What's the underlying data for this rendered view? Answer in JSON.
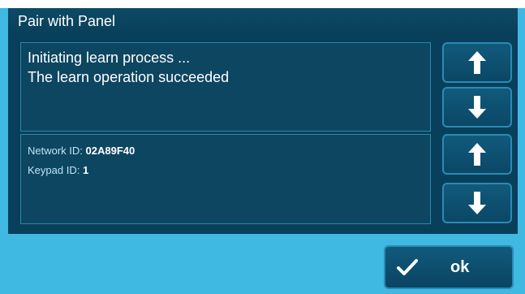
{
  "window": {
    "title": "Pair with Panel"
  },
  "log": {
    "lines": [
      "Initiating learn process ...",
      "The learn operation succeeded"
    ]
  },
  "info": {
    "network_id_label": "Network ID:",
    "network_id_value": "02A89F40",
    "keypad_id_label": "Keypad ID:",
    "keypad_id_value": "1"
  },
  "buttons": {
    "ok_label": "ok",
    "scroll_up_icon": "arrow-up-icon",
    "scroll_down_icon": "arrow-down-icon",
    "ok_icon": "checkmark-icon"
  },
  "colors": {
    "background": "#3fb8e2",
    "title_bar": "#0d4a66",
    "panel": "#0d4661",
    "panel_border": "#2d86a9"
  }
}
